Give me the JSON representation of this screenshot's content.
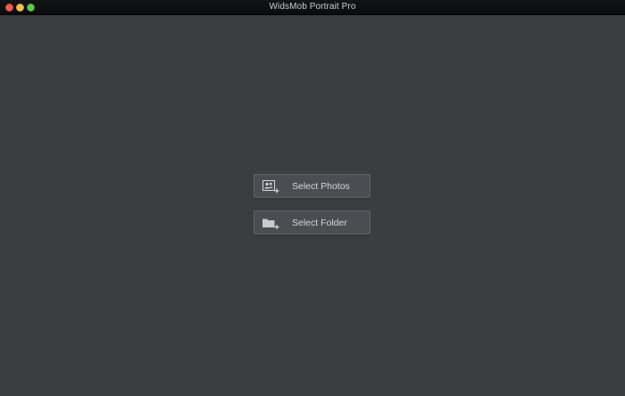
{
  "window": {
    "title": "WidsMob Portrait Pro"
  },
  "actions": {
    "select_photos_label": "Select Photos",
    "select_folder_label": "Select Folder"
  },
  "icons": {
    "select_photos": "add-photo-people-icon",
    "select_folder": "add-folder-icon"
  },
  "colors": {
    "background": "#3a3e41",
    "button_bg": "#4a4e52",
    "button_border": "#5d6165",
    "button_text": "#d6d8da",
    "close": "#ee5c55",
    "minimize": "#f5bf4f",
    "maximize": "#61c554"
  }
}
